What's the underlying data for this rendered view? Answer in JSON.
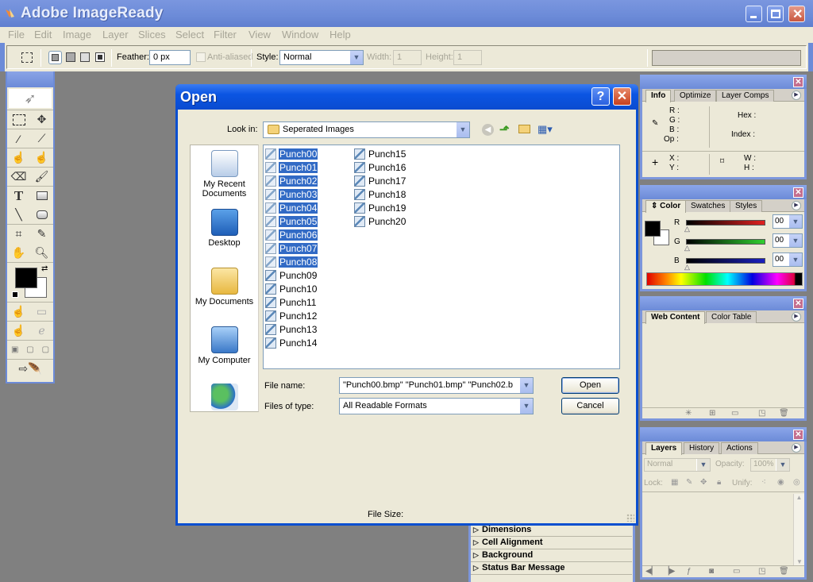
{
  "app": {
    "title": "Adobe ImageReady",
    "window_controls": [
      "minimize",
      "maximize",
      "close"
    ]
  },
  "menu": [
    "File",
    "Edit",
    "Image",
    "Layer",
    "Slices",
    "Select",
    "Filter",
    "View",
    "Window",
    "Help"
  ],
  "options_bar": {
    "feather_label": "Feather:",
    "feather_value": "0 px",
    "anti_aliased_label": "Anti-aliased",
    "style_label": "Style:",
    "style_value": "Normal",
    "width_label": "Width:",
    "width_value": "1",
    "height_label": "Height:",
    "height_value": "1"
  },
  "dialog": {
    "title": "Open",
    "look_in_label": "Look in:",
    "look_in_value": "Seperated Images",
    "places": [
      "My Recent Documents",
      "Desktop",
      "My Documents",
      "My Computer",
      ""
    ],
    "files": [
      {
        "name": "Punch00",
        "selected": true
      },
      {
        "name": "Punch01",
        "selected": true
      },
      {
        "name": "Punch02",
        "selected": true
      },
      {
        "name": "Punch03",
        "selected": true
      },
      {
        "name": "Punch04",
        "selected": true
      },
      {
        "name": "Punch05",
        "selected": true
      },
      {
        "name": "Punch06",
        "selected": true
      },
      {
        "name": "Punch07",
        "selected": true
      },
      {
        "name": "Punch08",
        "selected": true
      },
      {
        "name": "Punch09",
        "selected": false
      },
      {
        "name": "Punch10",
        "selected": false
      },
      {
        "name": "Punch11",
        "selected": false
      },
      {
        "name": "Punch12",
        "selected": false
      },
      {
        "name": "Punch13",
        "selected": false
      },
      {
        "name": "Punch14",
        "selected": false
      },
      {
        "name": "Punch15",
        "selected": false
      },
      {
        "name": "Punch16",
        "selected": false
      },
      {
        "name": "Punch17",
        "selected": false
      },
      {
        "name": "Punch18",
        "selected": false
      },
      {
        "name": "Punch19",
        "selected": false
      },
      {
        "name": "Punch20",
        "selected": false
      }
    ],
    "file_name_label": "File name:",
    "file_name_value": "\"Punch00.bmp\" \"Punch01.bmp\" \"Punch02.b",
    "files_of_type_label": "Files of type:",
    "files_of_type_value": "All Readable Formats",
    "open_button": "Open",
    "cancel_button": "Cancel",
    "file_size_label": "File Size:"
  },
  "info_panel": {
    "tabs": [
      "Info",
      "Optimize",
      "Layer Comps"
    ],
    "labels": {
      "r": "R :",
      "g": "G :",
      "b": "B :",
      "op": "Op :",
      "hex": "Hex :",
      "index": "Index :",
      "x": "X :",
      "y": "Y :",
      "w": "W :",
      "h": "H :"
    }
  },
  "color_panel": {
    "tabs": [
      "Color",
      "Swatches",
      "Styles"
    ],
    "channels": [
      {
        "label": "R",
        "value": "00"
      },
      {
        "label": "G",
        "value": "00"
      },
      {
        "label": "B",
        "value": "00"
      }
    ],
    "foreground": "#000000",
    "background": "#ffffff"
  },
  "web_content_panel": {
    "tabs": [
      "Web Content",
      "Color Table"
    ]
  },
  "layers_panel": {
    "tabs": [
      "Layers",
      "History",
      "Actions"
    ],
    "blend_mode": "Normal",
    "opacity_label": "Opacity:",
    "opacity_value": "100%",
    "lock_label": "Lock:",
    "unify_label": "Unify:"
  },
  "slice_sections": [
    "Dimensions",
    "Cell Alignment",
    "Background",
    "Status Bar Message"
  ]
}
